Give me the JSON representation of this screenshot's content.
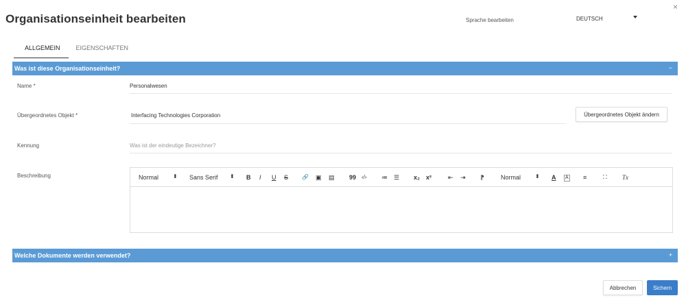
{
  "dialog": {
    "title": "Organisationseinheit bearbeiten",
    "close_glyph": "×"
  },
  "language": {
    "label": "Sprache bearbeiten",
    "selected": "DEUTSCH"
  },
  "tabs": [
    {
      "label": "ALLGEMEIN",
      "active": true
    },
    {
      "label": "EIGENSCHAFTEN",
      "active": false
    }
  ],
  "sections": [
    {
      "title": "Was ist diese Organisationseinheit?",
      "toggle": "−",
      "expanded": true
    },
    {
      "title": "Welche Dokumente werden verwendet?",
      "toggle": "+",
      "expanded": false
    }
  ],
  "fields": {
    "name": {
      "label": "Name *",
      "value": "Personalwesen"
    },
    "parent": {
      "label": "Übergeordnetes Objekt *",
      "value": "Interfacing Technologies Corporation",
      "button": "Übergeordnetes Objekt ändern"
    },
    "identifier": {
      "label": "Kennung",
      "placeholder": "Was ist der eindeutige Bezeichner?"
    },
    "description": {
      "label": "Beschreibung"
    }
  },
  "editor_toolbar": {
    "heading_select": "Normal",
    "font_select": "Sans Serif",
    "size_select": "Normal",
    "bold": "B",
    "italic": "I",
    "underline": "U",
    "strike": "S",
    "link": "🔗",
    "image": "▣",
    "video": "▤",
    "blockquote": "99",
    "code": "‹/›",
    "ordered_list": "≔",
    "bullet_list": "☰",
    "subscript": "x₂",
    "superscript": "x²",
    "outdent": "⇤",
    "indent": "⇥",
    "direction": "⁋",
    "text_color": "A",
    "background_color": "A",
    "align": "≡",
    "fullscreen": "⛶",
    "clean": "Tx",
    "select_arrow": "⬍"
  },
  "footer": {
    "cancel": "Abbrechen",
    "save": "Sichern"
  },
  "colors": {
    "section_bar": "#5b9bd5",
    "primary_button": "#3a7dc9"
  }
}
